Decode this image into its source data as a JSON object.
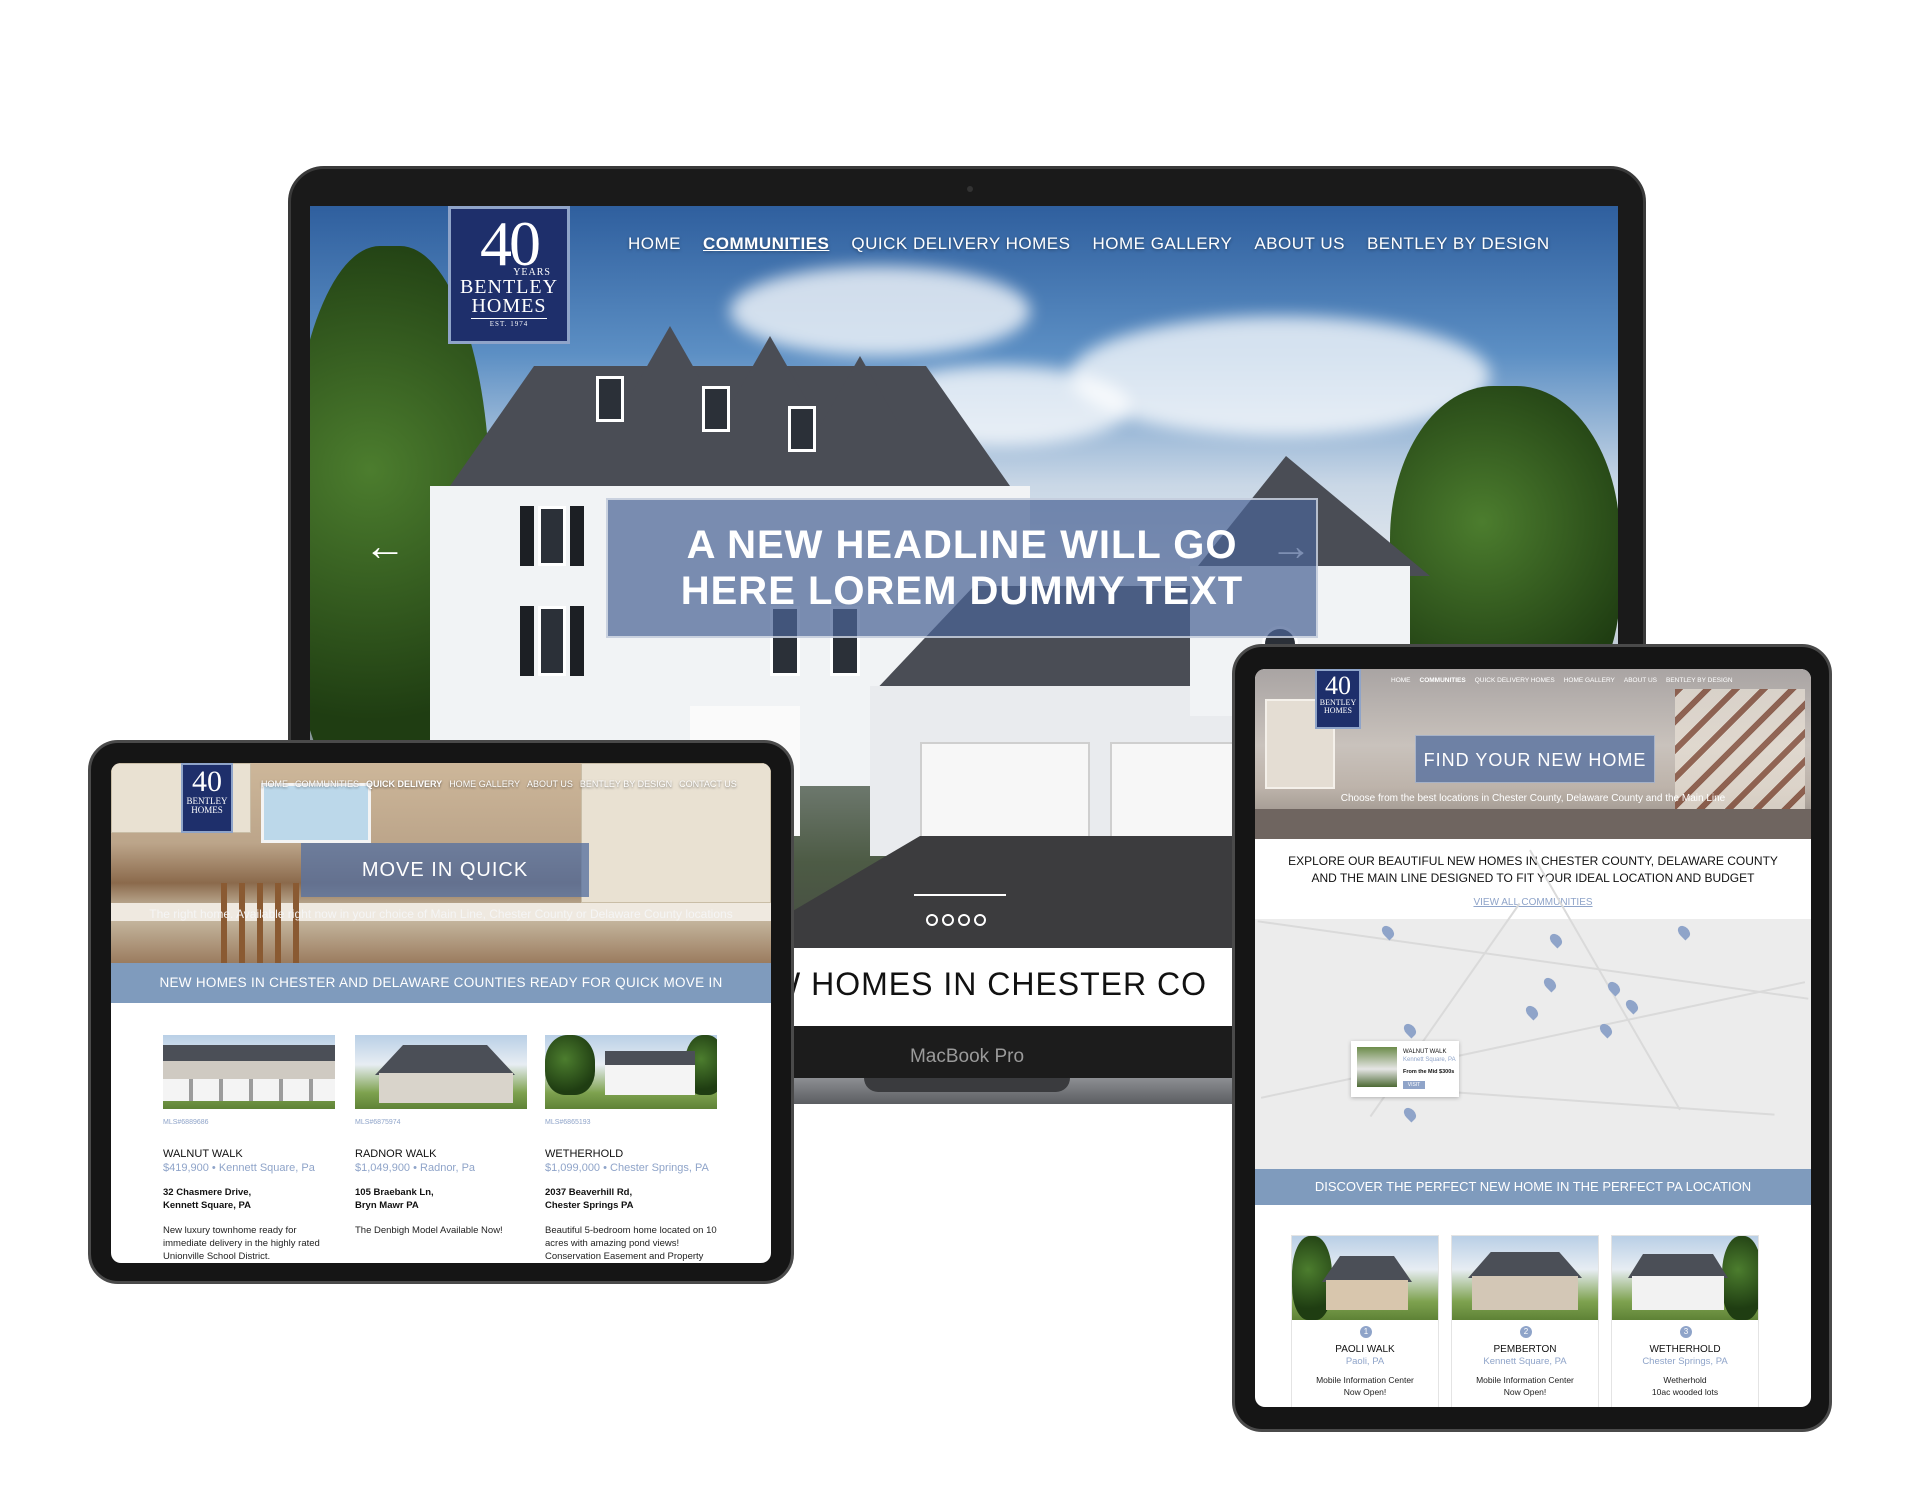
{
  "laptop": {
    "brand_label": "MacBook Pro",
    "logo": {
      "number": "40",
      "years": "YEARS",
      "name_line1": "BENTLEY",
      "name_line2": "HOMES",
      "est": "EST. 1974"
    },
    "nav": [
      "HOME",
      "COMMUNITIES",
      "QUICK DELIVERY HOMES",
      "HOME GALLERY",
      "ABOUT US",
      "BENTLEY BY DESIGN"
    ],
    "nav_active": "COMMUNITIES",
    "headline_line1": "A NEW HEADLINE WILL GO",
    "headline_line2": "HERE LOREM DUMMY TEXT",
    "prev_arrow": "←",
    "next_arrow": "→",
    "section_title_partial": "W HOMES IN CHESTER CO"
  },
  "tablet_left": {
    "logo": {
      "number": "40",
      "name_line1": "BENTLEY",
      "name_line2": "HOMES"
    },
    "nav": [
      "HOME",
      "COMMUNITIES",
      "QUICK DELIVERY",
      "HOME GALLERY",
      "ABOUT US",
      "BENTLEY BY DESIGN",
      "CONTACT US"
    ],
    "nav_active": "QUICK DELIVERY",
    "hero_title": "MOVE IN QUICK",
    "hero_subtitle": "The right home. Available right now in your choice of Main Line, Chester County or Delaware County locations",
    "band_title": "NEW HOMES IN CHESTER AND DELAWARE COUNTIES READY FOR QUICK MOVE IN",
    "listings": [
      {
        "mls": "MLS#6889686",
        "title": "WALNUT WALK",
        "price_loc": "$419,900 • Kennett Square, Pa",
        "addr1": "32 Chasmere Drive,",
        "addr2": "Kennett Square, PA",
        "desc": "New luxury townhome ready for immediate delivery in the highly rated Unionville School District."
      },
      {
        "mls": "MLS#6875974",
        "title": "RADNOR WALK",
        "price_loc": "$1,049,900 • Radnor, Pa",
        "addr1": "105 Braebank Ln,",
        "addr2": "Bryn Mawr PA",
        "desc": "The Denbigh Model Available Now!"
      },
      {
        "mls": "MLS#6865193",
        "title": "WETHERHOLD",
        "price_loc": "$1,099,000 • Chester Springs, PA",
        "addr1": "2037 Beaverhill Rd,",
        "addr2": "Chester Springs PA",
        "desc": "Beautiful 5-bedroom home located on 10 acres with amazing pond views! Conservation Easement and Property"
      }
    ]
  },
  "tablet_right": {
    "logo": {
      "number": "40",
      "name_line1": "BENTLEY",
      "name_line2": "HOMES"
    },
    "nav": [
      "HOME",
      "COMMUNITIES",
      "QUICK DELIVERY HOMES",
      "HOME GALLERY",
      "ABOUT US",
      "BENTLEY BY DESIGN"
    ],
    "nav_active": "COMMUNITIES",
    "hero_title": "FIND YOUR NEW HOME",
    "hero_subtitle": "Choose from the best locations in Chester County, Delaware County and the Main Line",
    "explore_line1": "EXPLORE OUR BEAUTIFUL NEW HOMES IN CHESTER COUNTY, DELAWARE COUNTY",
    "explore_line2": "AND THE MAIN LINE DESIGNED TO FIT YOUR IDEAL LOCATION AND BUDGET",
    "view_all": "VIEW ALL COMMUNITIES",
    "map_popup": {
      "title": "WALNUT WALK",
      "location": "Kennett Square, PA",
      "price": "From the Mid $300s",
      "button": "VISIT"
    },
    "band_title": "DISCOVER THE PERFECT NEW HOME IN THE PERFECT PA LOCATION",
    "communities": [
      {
        "num": "1",
        "name": "PAOLI WALK",
        "location": "Paoli, PA",
        "note_line1": "Mobile Information Center",
        "note_line2": "Now Open!"
      },
      {
        "num": "2",
        "name": "PEMBERTON",
        "location": "Kennett Square, PA",
        "note_line1": "Mobile Information Center",
        "note_line2": "Now Open!"
      },
      {
        "num": "3",
        "name": "WETHERHOLD",
        "location": "Chester Springs, PA",
        "note_line1": "Wetherhold",
        "note_line2": "10ac wooded lots"
      }
    ]
  },
  "colors": {
    "brand_navy": "#1e2f6b",
    "accent_blue": "#7f9bbd",
    "link_blue": "#8fa4c9",
    "device_frame": "#151515"
  }
}
